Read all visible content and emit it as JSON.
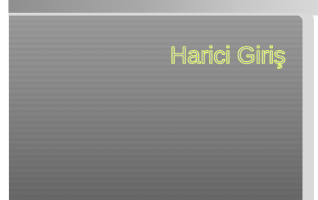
{
  "window": {
    "title": "Harici Giriş"
  }
}
